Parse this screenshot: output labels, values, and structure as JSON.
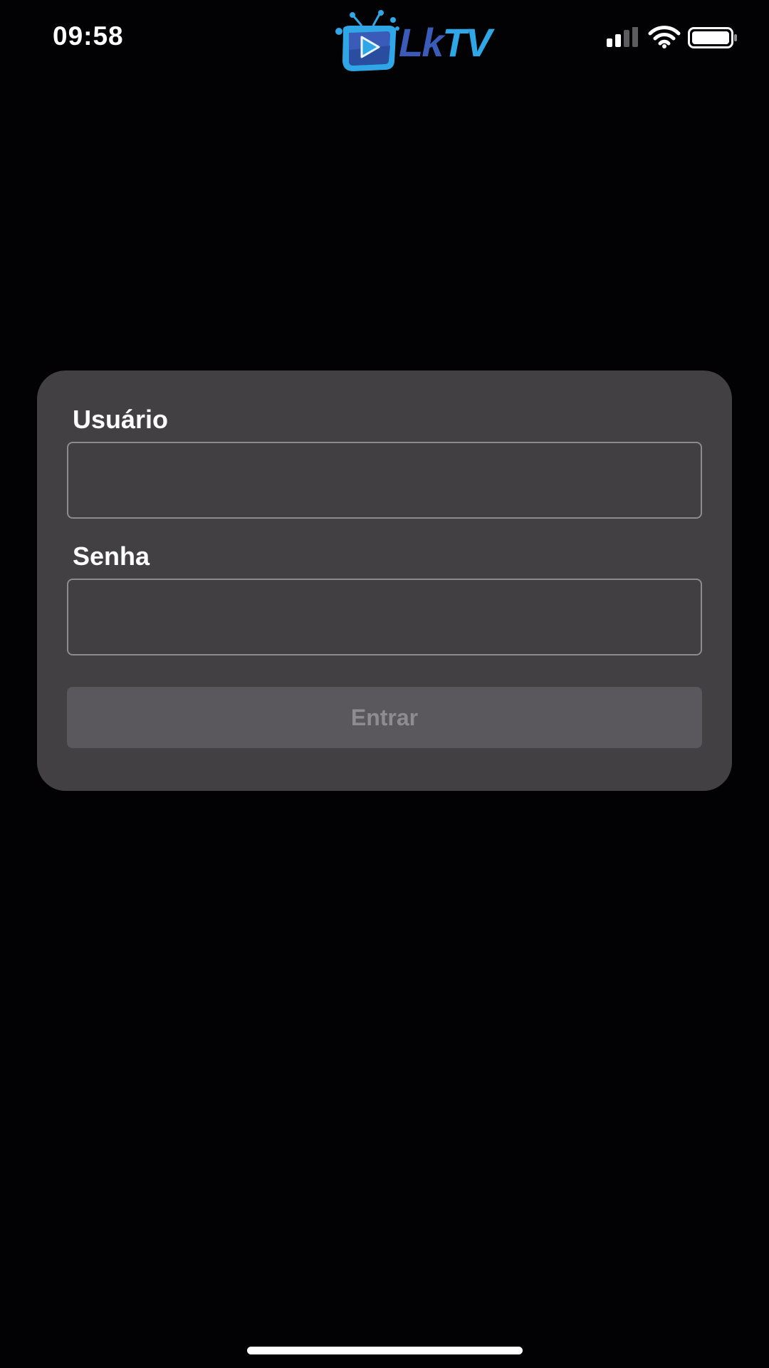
{
  "status_bar": {
    "time": "09:58",
    "signal_icon": "cellular-signal-icon",
    "wifi_icon": "wifi-icon",
    "battery_icon": "battery-icon"
  },
  "header": {
    "logo_text_lk": "Lk",
    "logo_text_tv": "TV",
    "logo_icon": "tv-play-logo-icon"
  },
  "login": {
    "username_label": "Usuário",
    "username_value": "",
    "password_label": "Senha",
    "password_value": "",
    "submit_label": "Entrar"
  },
  "colors": {
    "background": "#020103",
    "card": "#424043",
    "input_border": "#8d8b8f",
    "button_bg": "#5a585c",
    "button_text": "#8e8c90",
    "logo_blue_dark": "#3a5cb8",
    "logo_blue_light": "#2fa7e6"
  }
}
